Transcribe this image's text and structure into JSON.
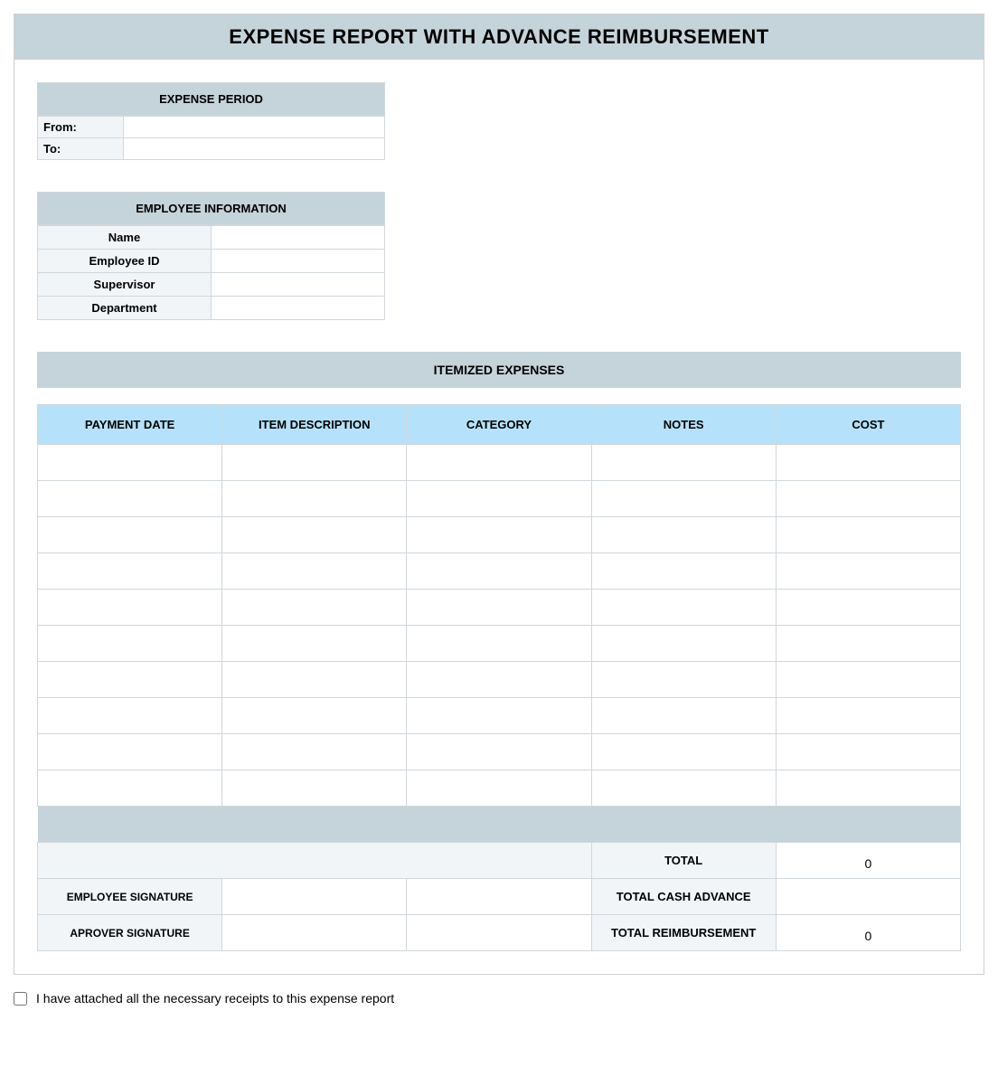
{
  "title": "EXPENSE REPORT WITH ADVANCE REIMBURSEMENT",
  "period": {
    "header": "EXPENSE PERIOD",
    "from_label": "From:",
    "from_value": "",
    "to_label": "To:",
    "to_value": ""
  },
  "employee": {
    "header": "EMPLOYEE INFORMATION",
    "rows": [
      {
        "label": "Name",
        "value": ""
      },
      {
        "label": "Employee ID",
        "value": ""
      },
      {
        "label": "Supervisor",
        "value": ""
      },
      {
        "label": "Department",
        "value": ""
      }
    ]
  },
  "itemized": {
    "header": "ITEMIZED EXPENSES",
    "columns": [
      "PAYMENT DATE",
      "ITEM DESCRIPTION",
      "CATEGORY",
      "NOTES",
      "COST"
    ],
    "rows": [
      {
        "date": "",
        "desc": "",
        "category": "",
        "notes": "",
        "cost": ""
      },
      {
        "date": "",
        "desc": "",
        "category": "",
        "notes": "",
        "cost": ""
      },
      {
        "date": "",
        "desc": "",
        "category": "",
        "notes": "",
        "cost": ""
      },
      {
        "date": "",
        "desc": "",
        "category": "",
        "notes": "",
        "cost": ""
      },
      {
        "date": "",
        "desc": "",
        "category": "",
        "notes": "",
        "cost": ""
      },
      {
        "date": "",
        "desc": "",
        "category": "",
        "notes": "",
        "cost": ""
      },
      {
        "date": "",
        "desc": "",
        "category": "",
        "notes": "",
        "cost": ""
      },
      {
        "date": "",
        "desc": "",
        "category": "",
        "notes": "",
        "cost": ""
      },
      {
        "date": "",
        "desc": "",
        "category": "",
        "notes": "",
        "cost": ""
      },
      {
        "date": "",
        "desc": "",
        "category": "",
        "notes": "",
        "cost": ""
      }
    ]
  },
  "totals": {
    "total_label": "TOTAL",
    "total_value": "0",
    "advance_label": "TOTAL CASH ADVANCE",
    "advance_value": "",
    "reimb_label": "TOTAL REIMBURSEMENT",
    "reimb_value": "0"
  },
  "signatures": {
    "employee_label": "EMPLOYEE SIGNATURE",
    "approver_label": "APROVER SIGNATURE"
  },
  "confirmation": {
    "label": "I have attached all the necessary receipts to this expense report"
  }
}
